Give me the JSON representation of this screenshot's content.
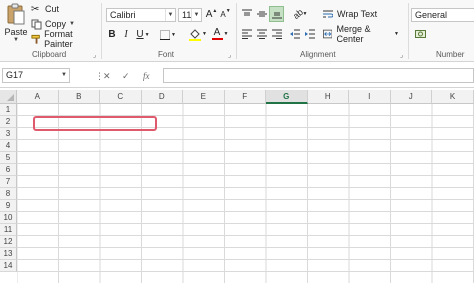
{
  "clipboard": {
    "paste_label": "Paste",
    "cut_label": "Cut",
    "copy_label": "Copy",
    "format_painter_label": "Format Painter",
    "group_label": "Clipboard"
  },
  "font": {
    "family": "Calibri",
    "size": "11",
    "bold": "B",
    "italic": "I",
    "underline": "U",
    "grow": "A",
    "shrink": "A",
    "color_letter": "A",
    "group_label": "Font"
  },
  "alignment": {
    "wrap_text_label": "Wrap Text",
    "merge_center_label": "Merge & Center",
    "group_label": "Alignment"
  },
  "number": {
    "format": "General",
    "group_label": "Number"
  },
  "formula_bar": {
    "name_box": "G17",
    "fx": "fx",
    "cancel": "✕",
    "enter": "✓"
  },
  "grid": {
    "columns": [
      "A",
      "B",
      "C",
      "D",
      "E",
      "F",
      "G",
      "H",
      "I",
      "J",
      "K"
    ],
    "active_column": "G",
    "rows": [
      "1",
      "2",
      "3",
      "4",
      "5",
      "6",
      "7",
      "8",
      "9",
      "10",
      "11",
      "12",
      "13",
      "14"
    ]
  },
  "colors": {
    "excel_green": "#217346",
    "highlight": "#e05a6d",
    "fill_yellow": "#ffff00",
    "font_red": "#e00000"
  }
}
